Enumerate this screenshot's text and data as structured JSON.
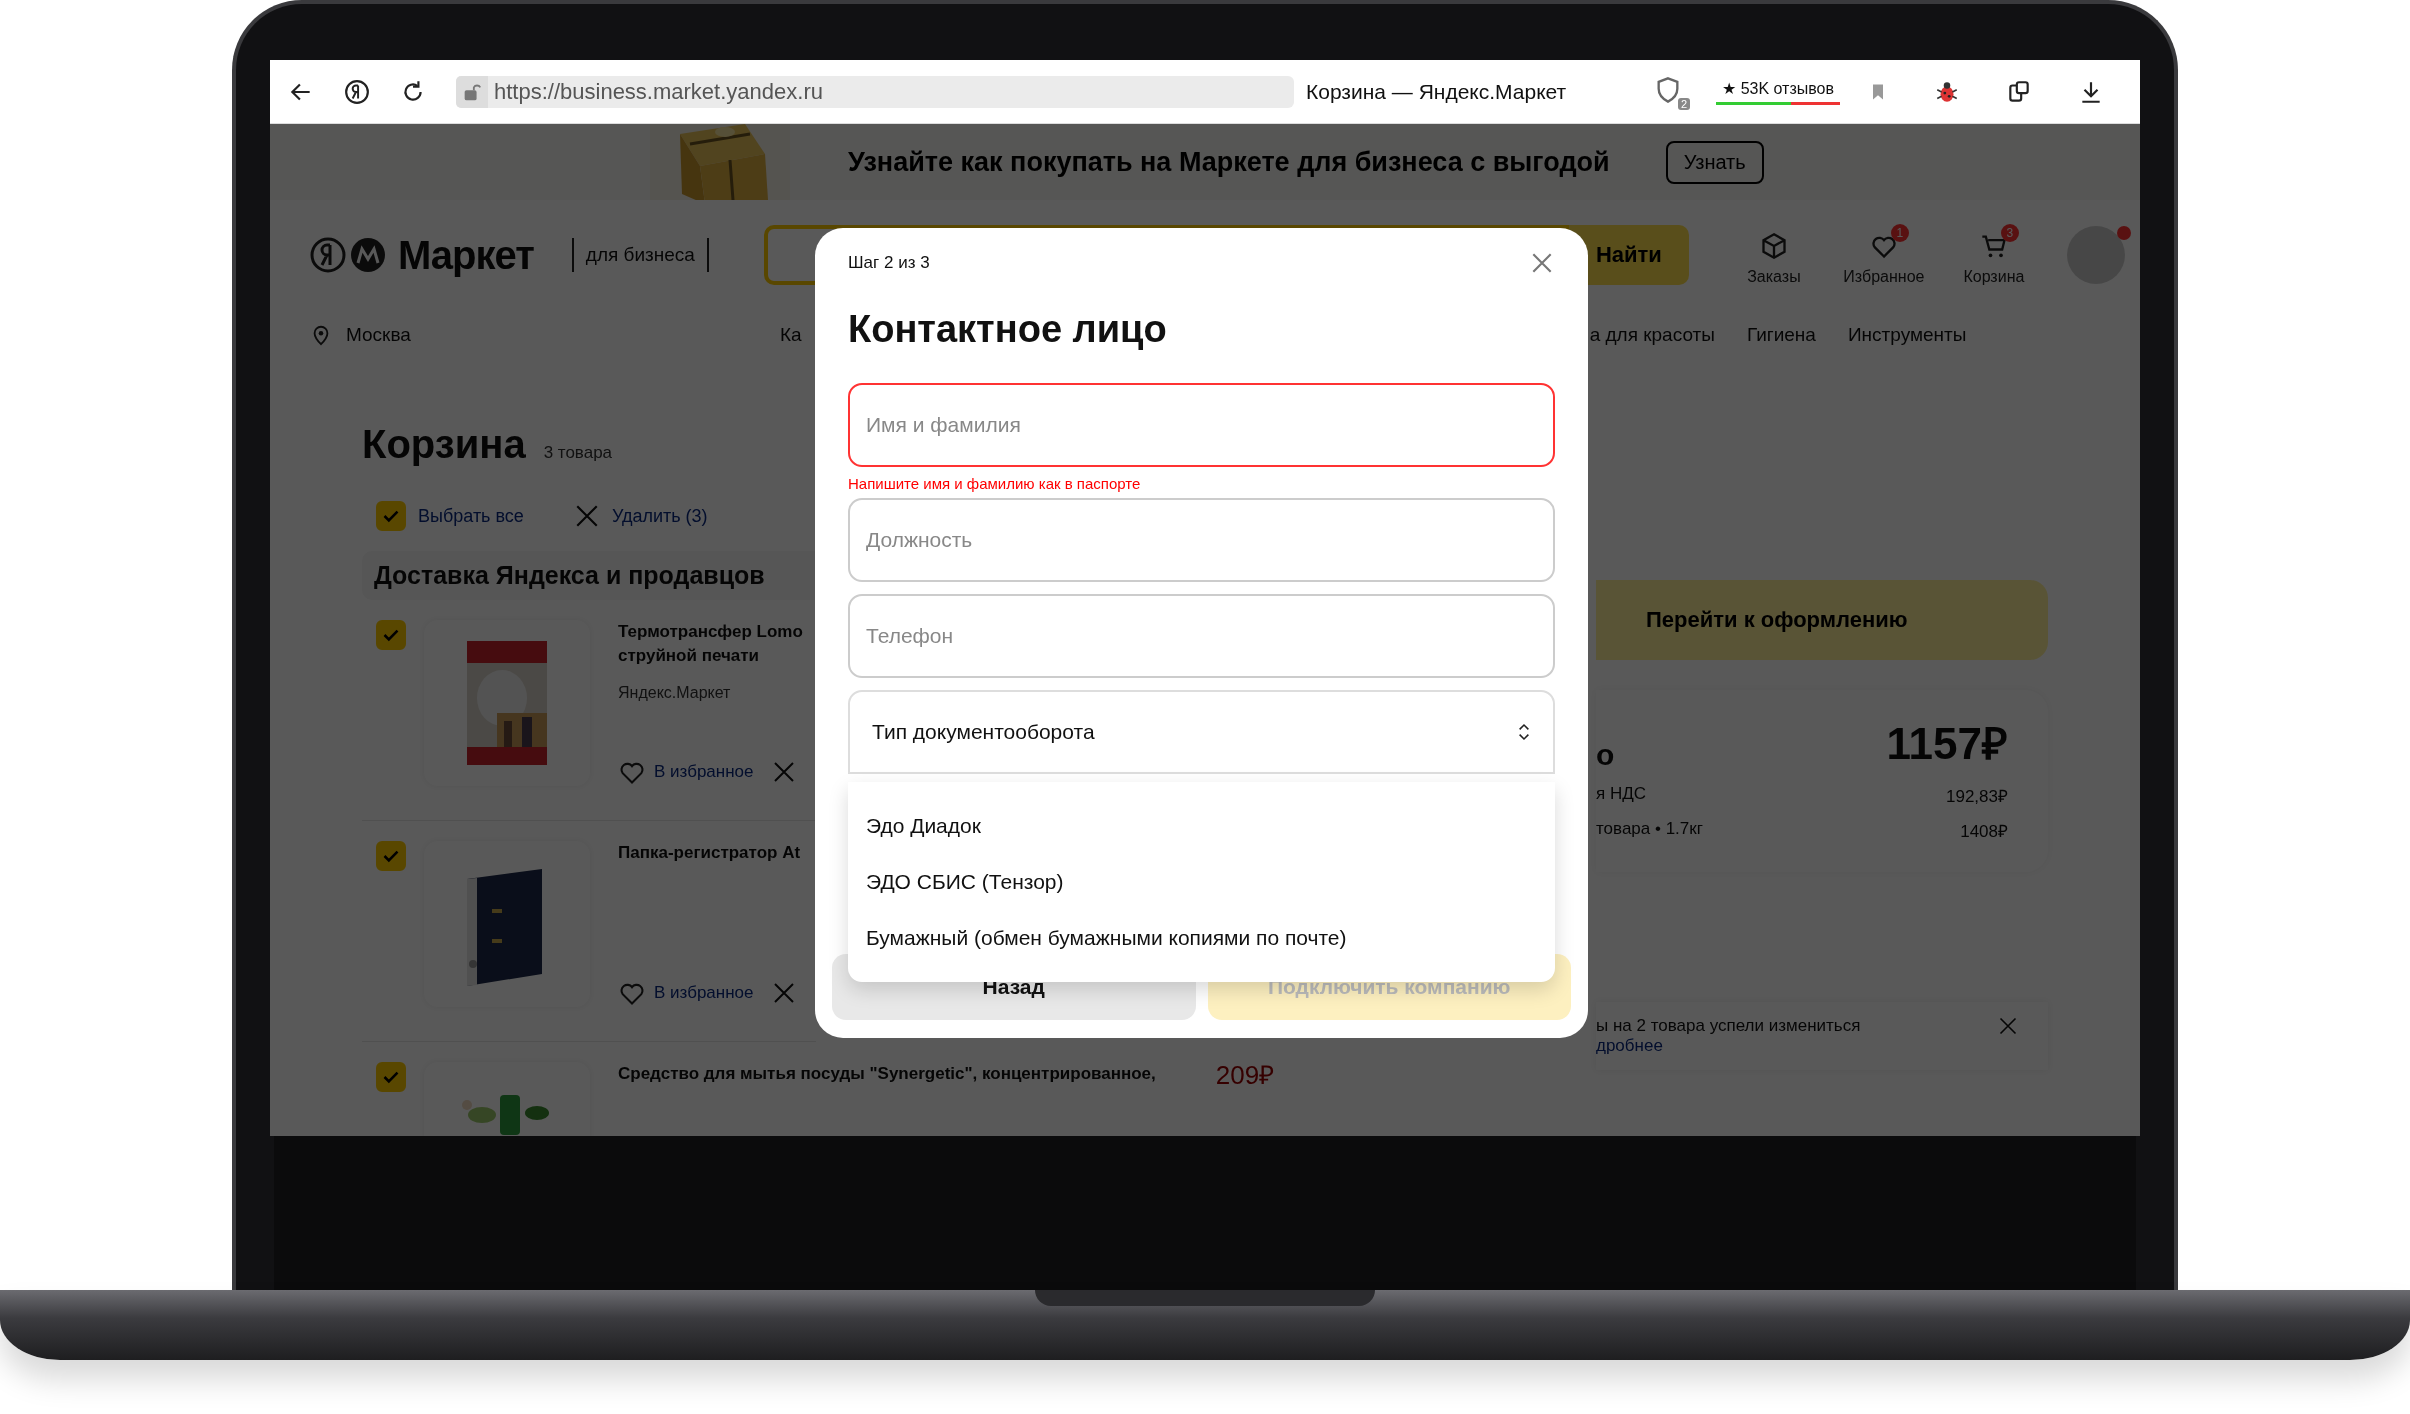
{
  "browser": {
    "url": "https://business.market.yandex.ru",
    "title": "Корзина — Яндекс.Маркет",
    "shield_badge": "2",
    "reviews": "★ 53K отзывов"
  },
  "promo_banner": {
    "text": "Узнайте как покупать на Маркете для бизнеса с выгодой",
    "button": "Узнать"
  },
  "header": {
    "logo": "Маркет",
    "subtitle": "для бизнеса",
    "search_button": "Найти",
    "avatar_notification": true,
    "actions": [
      {
        "kind": "orders",
        "label": "Заказы"
      },
      {
        "kind": "favorites",
        "label": "Избранное",
        "badge": "1"
      },
      {
        "kind": "cart",
        "label": "Корзина",
        "badge": "3"
      }
    ]
  },
  "location": "Москва",
  "nav": [
    "Ка",
    "а для красоты",
    "Гигиена",
    "Инструменты"
  ],
  "cart": {
    "title": "Корзина",
    "count": "3 товара",
    "select_all": {
      "label": "Выбрать все",
      "checked": true
    },
    "delete": "Удалить (3)",
    "section": "Доставка Яндекса и продавцов",
    "items": [
      {
        "checked": true,
        "title_lines": [
          "Термотрансфер Lomo",
          "струйной печати"
        ],
        "seller": "Яндекс.Маркет",
        "favorite": "В избранное"
      },
      {
        "checked": true,
        "title_lines": [
          "Папка-регистратор At"
        ],
        "favorite": "В избранное"
      },
      {
        "checked": true,
        "title_lines": [
          "Средство для мытья посуды \"Synergetic\", концентрированное,"
        ],
        "price": "209₽"
      }
    ]
  },
  "checkout": {
    "button": "Перейти к оформлению"
  },
  "summary": {
    "total_label": "о",
    "total": "1157₽",
    "rows": [
      {
        "label": "я НДС",
        "value": "192,83₽"
      },
      {
        "label": "товара • 1.7кг",
        "value": "1408₽"
      }
    ]
  },
  "notice": {
    "text": "ы на 2 товара успели измениться",
    "link": "дробнее"
  },
  "modal": {
    "step": "Шаг 2 из 3",
    "title": "Контактное лицо",
    "fields": [
      {
        "placeholder": "Имя и фамилия",
        "error": "Напишите имя и фамилию как в паспорте"
      },
      {
        "placeholder": "Должность"
      },
      {
        "placeholder": "Телефон"
      }
    ],
    "select": {
      "value": "Тип документооборота",
      "expanded": true,
      "options": [
        "Эдо Диадок",
        "ЭДО СБИС (Тензор)",
        "Бумажный (обмен бумажными копиями по почте)"
      ]
    },
    "buttons": [
      {
        "label": "Назад",
        "kind": "secondary",
        "disabled": false
      },
      {
        "label": "Подключить компанию",
        "kind": "primary",
        "disabled": true
      }
    ]
  }
}
